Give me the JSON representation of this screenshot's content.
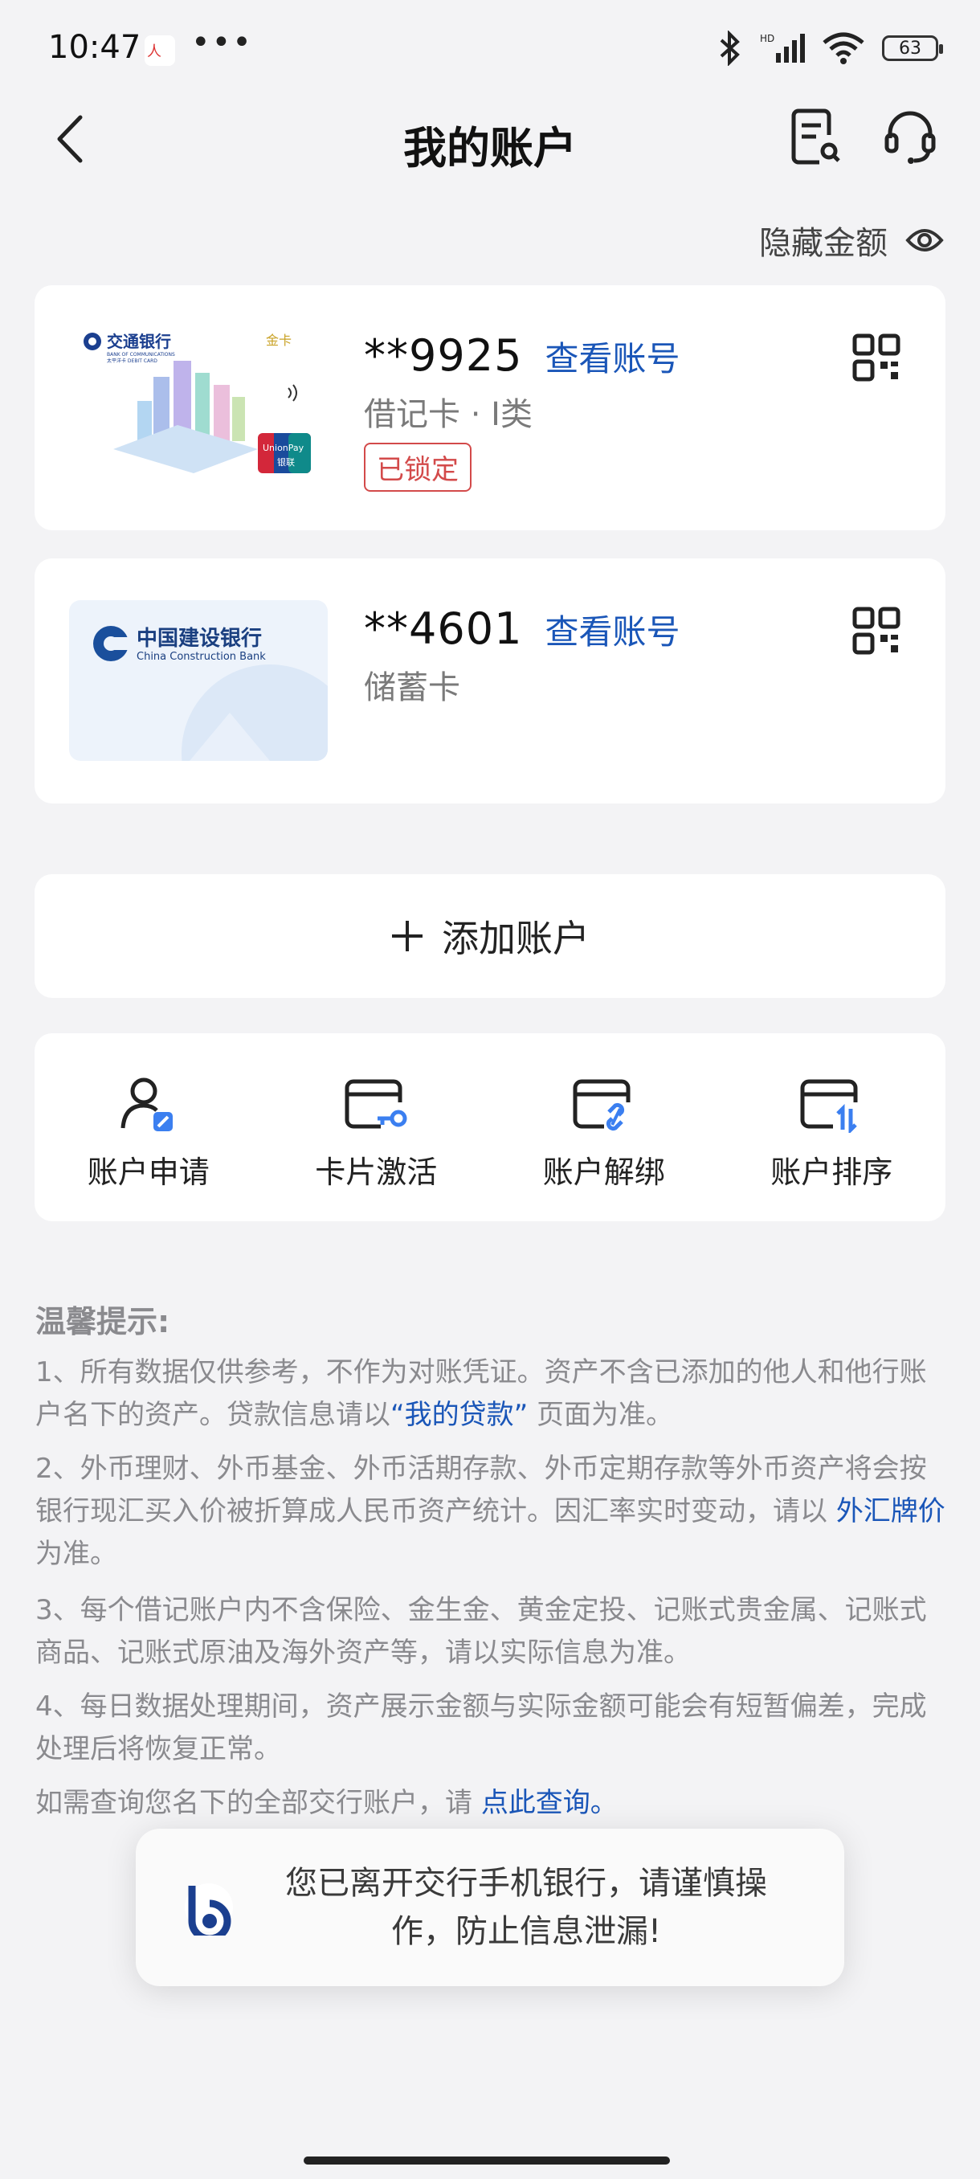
{
  "status_bar": {
    "time": "10:47",
    "dots": "•••",
    "battery": "63"
  },
  "header": {
    "title": "我的账户"
  },
  "hide_amount": {
    "label": "隐藏金额"
  },
  "accounts": [
    {
      "bank_name": "交通银行",
      "bank_en": "BANK OF COMMUNICATIONS",
      "card_sub": "太平洋卡 DEBIT CARD",
      "card_tag": "金卡",
      "number": "**9925",
      "view_label": "查看账号",
      "type": "借记卡 · I类",
      "status": "已锁定"
    },
    {
      "bank_name": "中国建设银行",
      "bank_en": "China Construction Bank",
      "number": "**4601",
      "view_label": "查看账号",
      "type": "储蓄卡"
    }
  ],
  "add_account": {
    "label": "添加账户"
  },
  "actions": [
    {
      "label": "账户申请",
      "icon": "user-edit-icon"
    },
    {
      "label": "卡片激活",
      "icon": "card-key-icon"
    },
    {
      "label": "账户解绑",
      "icon": "card-unlink-icon"
    },
    {
      "label": "账户排序",
      "icon": "card-sort-icon"
    }
  ],
  "tips": {
    "title": "温馨提示:",
    "t1_a": "1、所有数据仅供参考，不作为对账凭证。资产不含已添加的他人和他行账户名下的资产。贷款信息请以",
    "t1_link": "“我的贷款”",
    "t1_b": "页面为准。",
    "t2_a": "2、外币理财、外币基金、外币活期存款、外币定期存款等外币资产将会按银行现汇买入价被折算成人民币资产统计。因汇率实时变动，请以",
    "t2_link": "外汇牌价",
    "t2_b": "为准。",
    "t3": "3、每个借记账户内不含保险、金生金、黄金定投、记账式贵金属、记账式商品、记账式原油及海外资产等，请以实际信息为准。",
    "t4": "4、每日数据处理期间，资产展示金额与实际金额可能会有短暂偏差，完成处理后将恢复正常。",
    "t5_a": "如需查询您名下的全部交行账户，请",
    "t5_link": "点此查询。"
  },
  "toast": {
    "text": "您已离开交行手机银行，请谨慎操作，防止信息泄漏!"
  },
  "colors": {
    "link": "#1a56b8",
    "locked": "#d34a4a",
    "bg": "#f3f3f5"
  }
}
